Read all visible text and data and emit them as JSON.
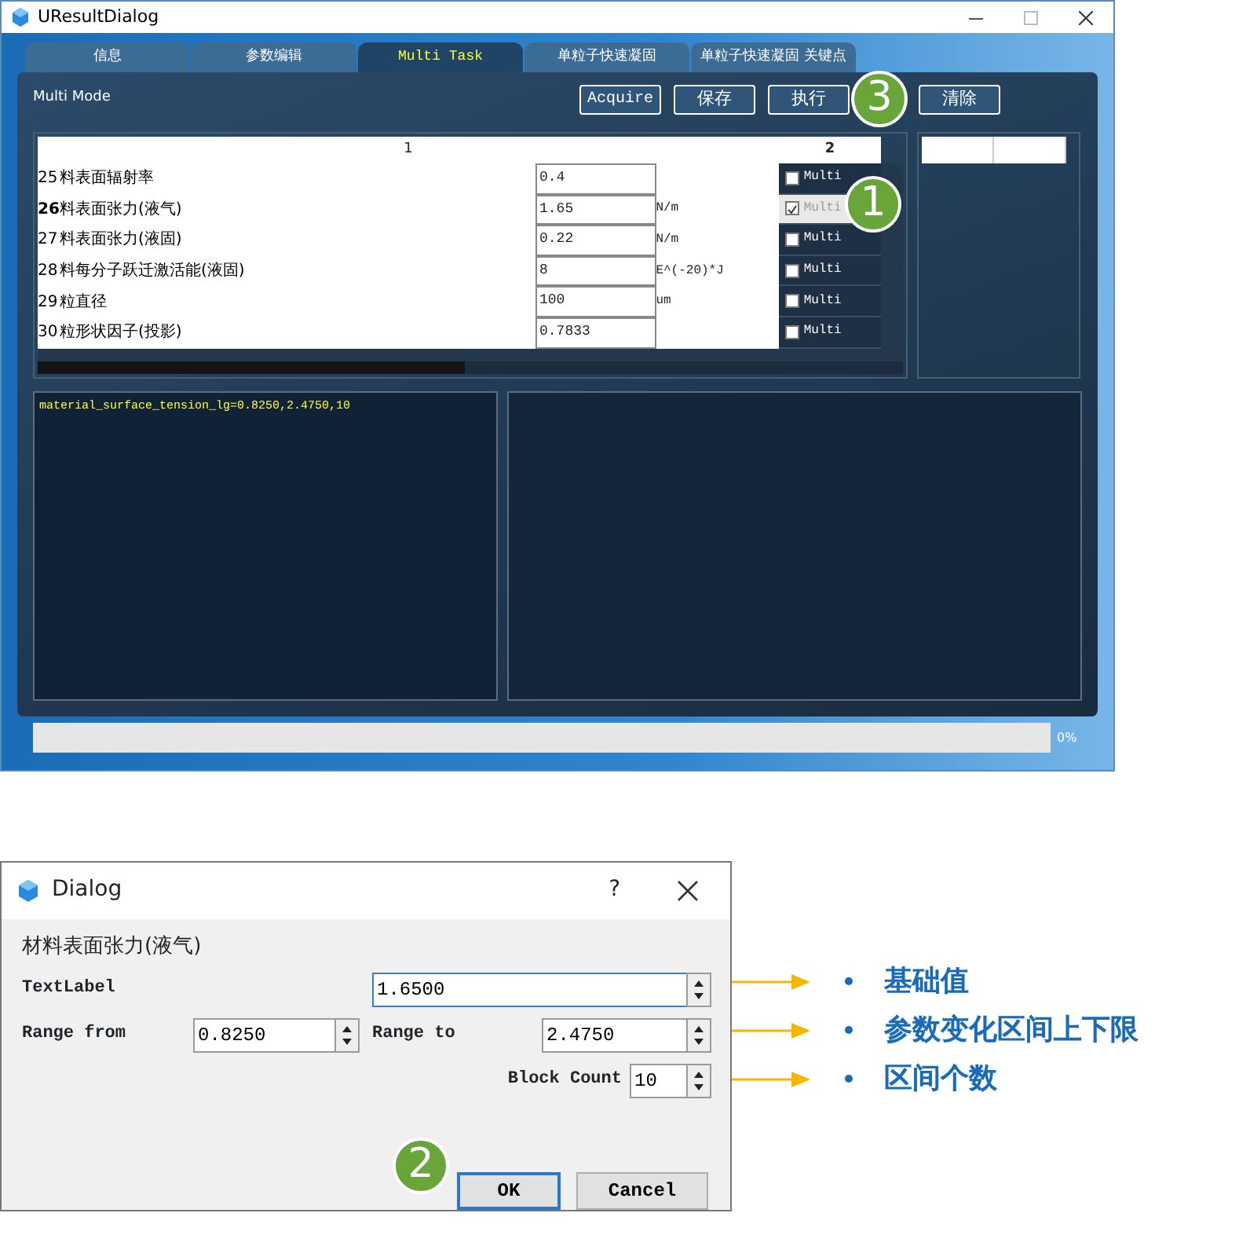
{
  "main_window": {
    "title": "UResultDialog",
    "tabs": [
      {
        "label": "信息",
        "selected": false
      },
      {
        "label": "参数编辑",
        "selected": false
      },
      {
        "label": "Multi Task",
        "selected": true
      },
      {
        "label": "单粒子快速凝固",
        "selected": false
      },
      {
        "label": "单粒子快速凝固 关键点",
        "selected": false
      }
    ],
    "mode_label": "Multi Mode",
    "buttons": [
      "Acquire",
      "保存",
      "执行",
      "清除"
    ],
    "table": {
      "columns": [
        "1",
        "2"
      ],
      "rows": [
        {
          "number": "25",
          "name": "料表面辐射率",
          "value": "0.4",
          "unit": "",
          "multi_label": "Multi",
          "checked": false,
          "selected": false
        },
        {
          "number": "26",
          "name": "料表面张力(液气)",
          "value": "1.65",
          "unit": "N/m",
          "multi_label": "Multi",
          "checked": true,
          "selected": true
        },
        {
          "number": "27",
          "name": "料表面张力(液固)",
          "value": "0.22",
          "unit": "N/m",
          "multi_label": "Multi",
          "checked": false,
          "selected": false
        },
        {
          "number": "28",
          "name": "料每分子跃迁激活能(液固)",
          "value": "8",
          "unit": "E^(-20)*J",
          "multi_label": "Multi",
          "checked": false,
          "selected": false
        },
        {
          "number": "29",
          "name": "粒直径",
          "value": "100",
          "unit": "um",
          "multi_label": "Multi",
          "checked": false,
          "selected": false
        },
        {
          "number": "30",
          "name": "粒形状因子(投影)",
          "value": "0.7833",
          "unit": "",
          "multi_label": "Multi",
          "checked": false,
          "selected": false
        }
      ]
    },
    "log_text": "material_surface_tension_lg=0.8250,2.4750,10",
    "progress": {
      "level": 0,
      "reading": "0%"
    }
  },
  "dialog": {
    "title": "Dialog",
    "help": "?",
    "heading": "材料表面张力(液气)",
    "fields": [
      {
        "label": "TextLabel",
        "value": "1.6500"
      },
      {
        "label": "Range from",
        "value": "0.8250"
      },
      {
        "label": "Range to",
        "value": "2.4750"
      },
      {
        "label": "Block Count",
        "value": "10"
      }
    ],
    "buttons": [
      "OK",
      "Cancel"
    ]
  },
  "annotations": [
    "基础值",
    "参数变化区间上下限",
    "区间个数"
  ],
  "badges": [
    "3",
    "1",
    "2"
  ]
}
